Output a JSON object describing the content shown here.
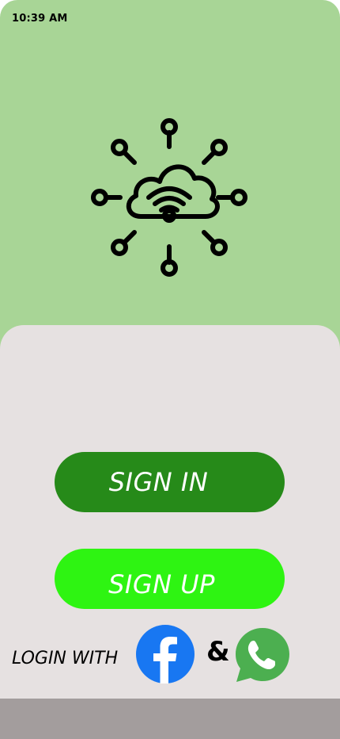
{
  "status_bar": {
    "time": "10:39  AM"
  },
  "logo": {
    "icon": "cloud-network-icon"
  },
  "actions": {
    "sign_in_label": "SIGN IN",
    "sign_up_label": "SIGN UP"
  },
  "social": {
    "login_with_label": "LOGIN WITH",
    "separator": "&",
    "facebook_icon": "facebook-icon",
    "whatsapp_icon": "whatsapp-icon"
  },
  "colors": {
    "header_bg": "#a8d596",
    "sheet_bg": "#e6e1e1",
    "sign_in_bg": "#268a19",
    "sign_up_bg": "#2ef412",
    "facebook_blue": "#1877f2",
    "whatsapp_green": "#4caf50",
    "bottom_bar": "#a39d9d"
  }
}
